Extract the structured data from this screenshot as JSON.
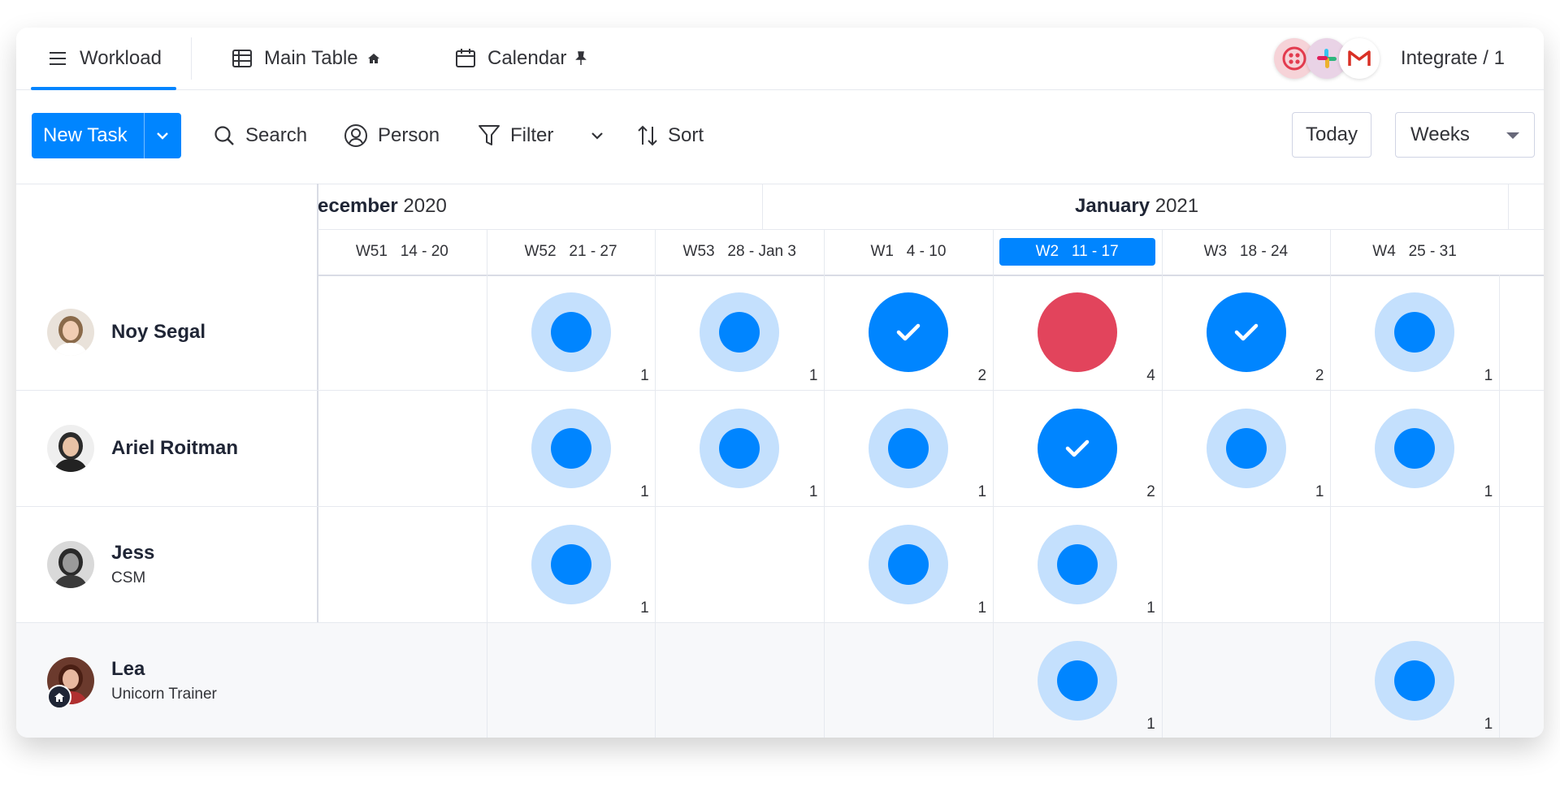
{
  "tabs": [
    {
      "label": "Workload",
      "icon": "hamburger-icon",
      "active": true
    },
    {
      "label": "Main Table",
      "icon": "table-icon",
      "badge_icon": "home-icon"
    },
    {
      "label": "Calendar",
      "icon": "calendar-icon",
      "badge_icon": "pin-icon"
    }
  ],
  "integrations": {
    "apps": [
      "twilio-icon",
      "slack-icon",
      "gmail-icon"
    ],
    "label": "Integrate / 1"
  },
  "toolbar": {
    "new_task": "New Task",
    "search": "Search",
    "person": "Person",
    "filter": "Filter",
    "sort": "Sort",
    "today": "Today",
    "view_select": "Weeks"
  },
  "timeline": {
    "months": [
      {
        "name": "ecember",
        "year": "2020"
      },
      {
        "name": "January",
        "year": "2021"
      }
    ],
    "weeks": [
      {
        "label": "W51   14 - 20"
      },
      {
        "label": "W52   21 - 27"
      },
      {
        "label": "W53   28 - Jan 3"
      },
      {
        "label": "W1   4 - 10"
      },
      {
        "label": "W2   11 - 17",
        "current": true
      },
      {
        "label": "W3   18 - 24"
      },
      {
        "label": "W4   25 - 31"
      }
    ]
  },
  "colors": {
    "primary": "#0085ff",
    "light_blue": "#c4e0fd",
    "overloaded": "#e2445c"
  },
  "people": [
    {
      "name": "Noy Segal",
      "role": "",
      "cells": [
        null,
        {
          "state": "partial",
          "count": "1"
        },
        {
          "state": "partial",
          "count": "1"
        },
        {
          "state": "full",
          "count": "2"
        },
        {
          "state": "over",
          "count": "4"
        },
        {
          "state": "full",
          "count": "2"
        },
        {
          "state": "partial",
          "count": "1"
        }
      ]
    },
    {
      "name": "Ariel Roitman",
      "role": "",
      "cells": [
        null,
        {
          "state": "partial",
          "count": "1"
        },
        {
          "state": "partial",
          "count": "1"
        },
        {
          "state": "partial",
          "count": "1"
        },
        {
          "state": "full",
          "count": "2"
        },
        {
          "state": "partial",
          "count": "1"
        },
        {
          "state": "partial",
          "count": "1"
        }
      ]
    },
    {
      "name": "Jess",
      "role": "CSM",
      "cells": [
        null,
        {
          "state": "partial",
          "count": "1"
        },
        null,
        {
          "state": "partial",
          "count": "1"
        },
        {
          "state": "partial",
          "count": "1"
        },
        null,
        null
      ]
    },
    {
      "name": "Lea",
      "role": "Unicorn Trainer",
      "badge": "home-icon",
      "cells": [
        null,
        null,
        null,
        null,
        {
          "state": "partial",
          "count": "1"
        },
        null,
        {
          "state": "partial",
          "count": "1"
        }
      ]
    }
  ]
}
